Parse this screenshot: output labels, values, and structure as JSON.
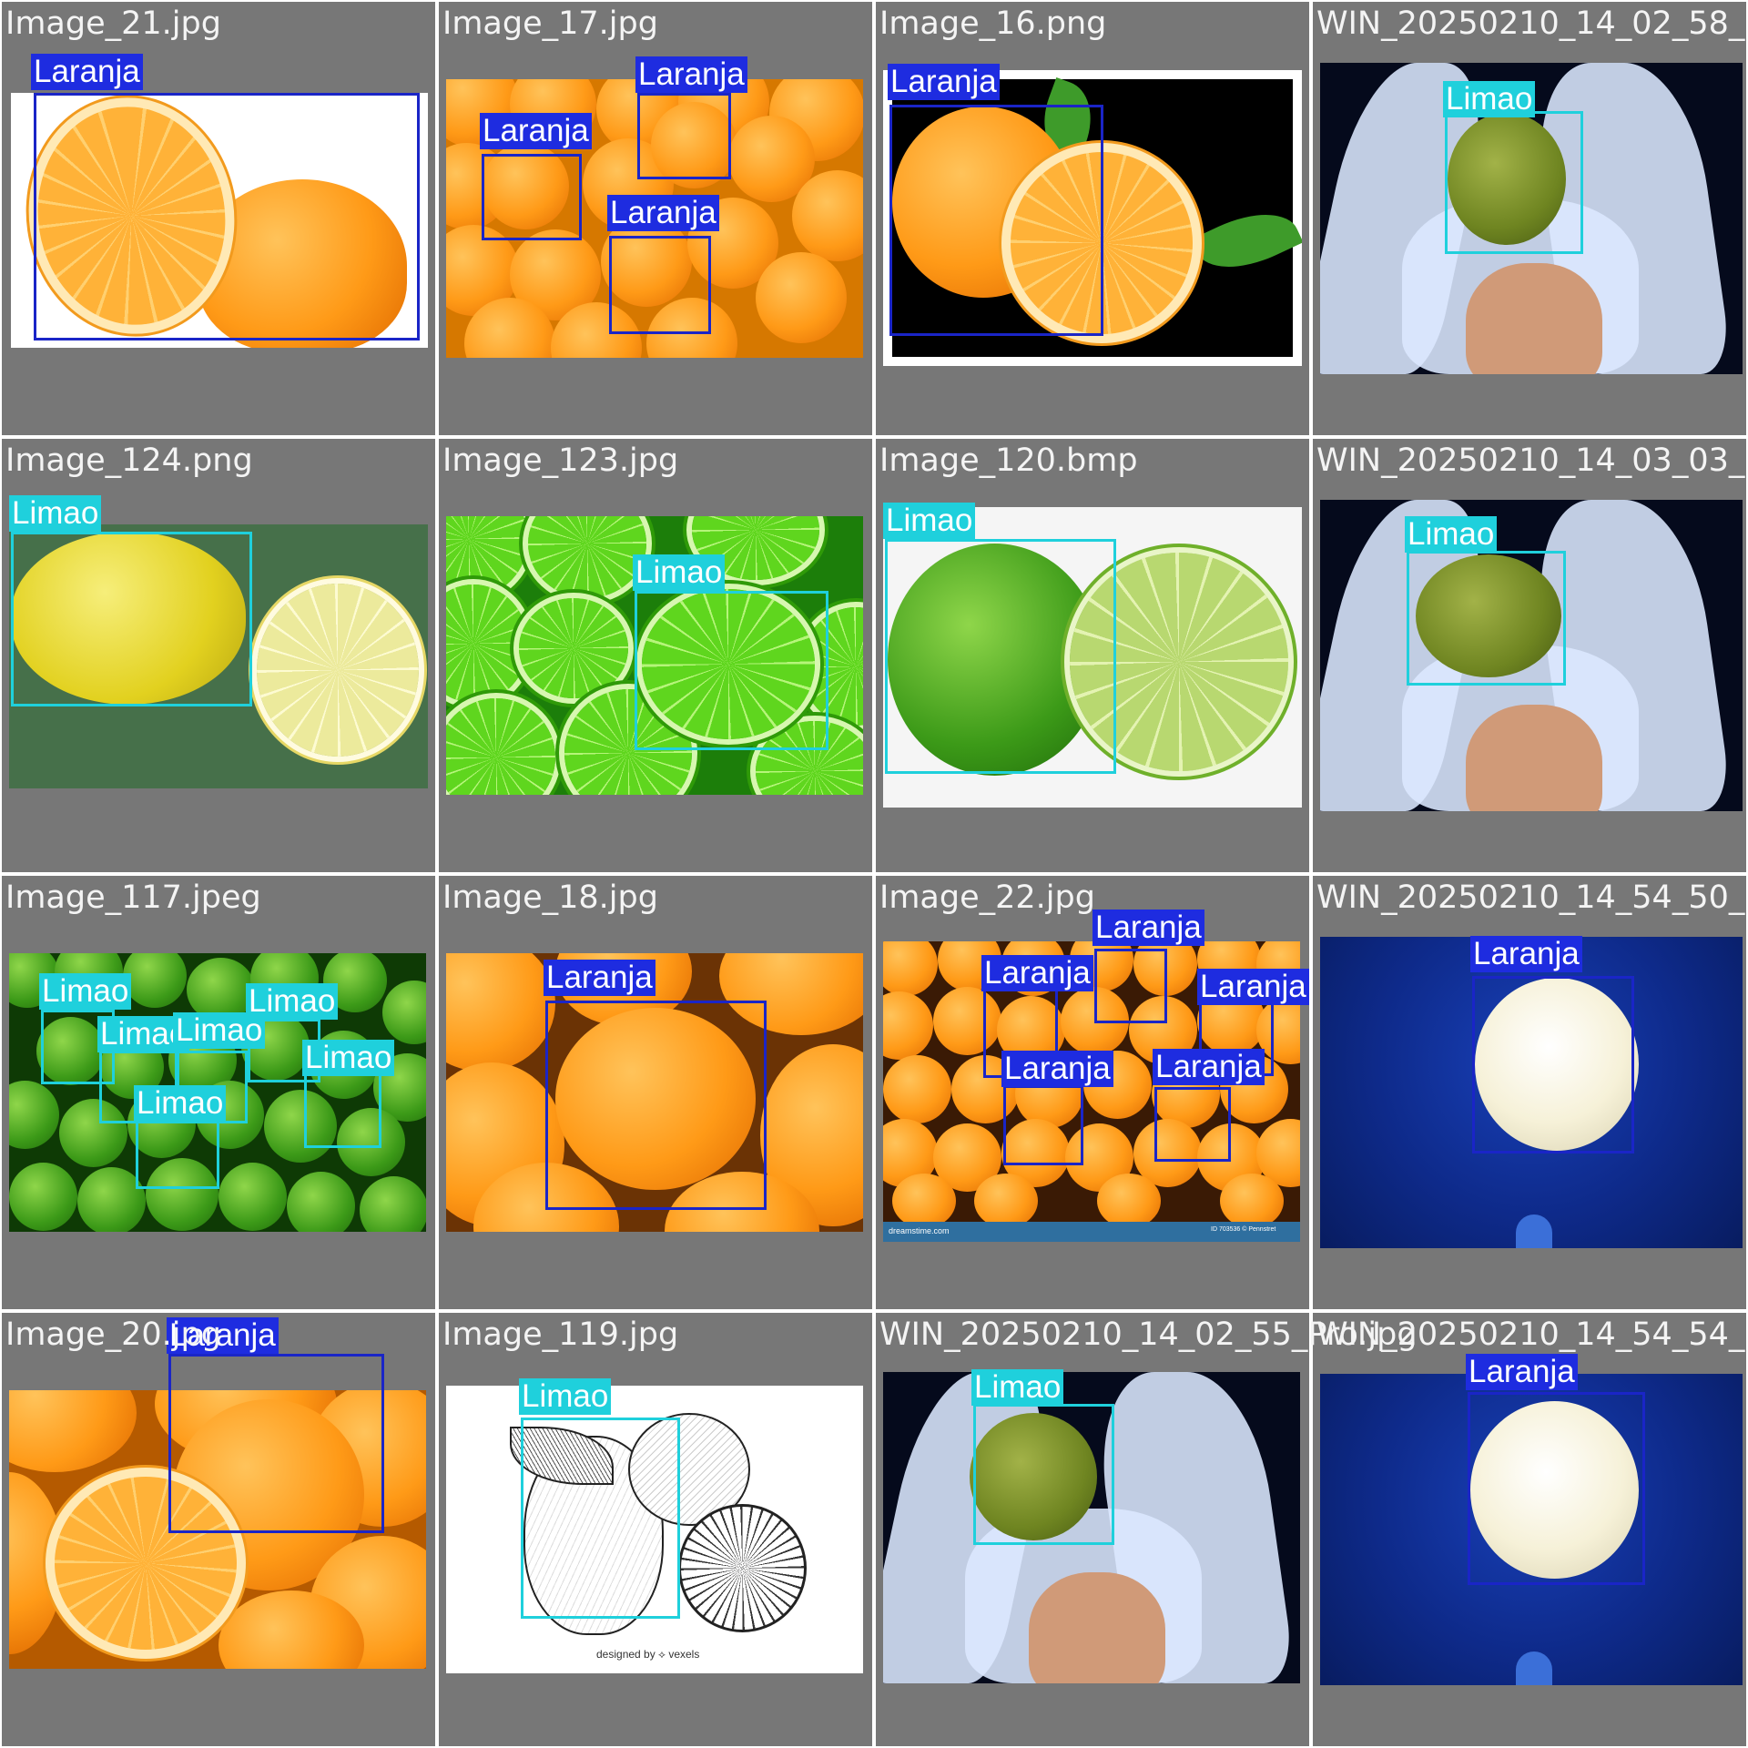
{
  "colors": {
    "laranja_box": "#1a25c7",
    "laranja_label_bg": "#1e2ce0",
    "limao_box": "#1fd0dc",
    "limao_label_bg": "#1fd0dc",
    "tile_background": "#777777"
  },
  "labels": {
    "laranja": "Laranja",
    "limao": "Limao"
  },
  "tiles": [
    {
      "filename": "Image_21.jpg"
    },
    {
      "filename": "Image_17.jpg"
    },
    {
      "filename": "Image_16.png"
    },
    {
      "filename": "WIN_20250210_14_02_58_"
    },
    {
      "filename": "Image_124.png"
    },
    {
      "filename": "Image_123.jpg"
    },
    {
      "filename": "Image_120.bmp"
    },
    {
      "filename": "WIN_20250210_14_03_03_"
    },
    {
      "filename": "Image_117.jpeg"
    },
    {
      "filename": "Image_18.jpg"
    },
    {
      "filename": "Image_22.jpg",
      "watermark": "dreamstime.com",
      "watermark_id": "ID 703536 © Pennstret"
    },
    {
      "filename": "WIN_20250210_14_54_50_"
    },
    {
      "filename": "Image_20.jpg"
    },
    {
      "filename": "Image_119.jpg",
      "credit": "designed by ⟡ vexels"
    },
    {
      "filename": "WIN_20250210_14_02_55_Pro.jpg"
    },
    {
      "filename": "WIN_20250210_14_54_54_"
    }
  ]
}
